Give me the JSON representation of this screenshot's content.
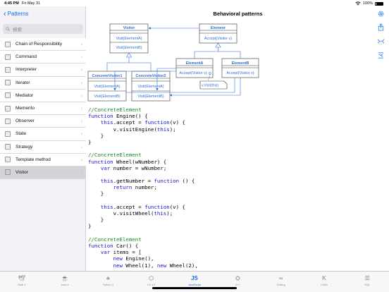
{
  "status": {
    "time": "4:45 PM",
    "date": "Fri May 31",
    "battery": "100%"
  },
  "nav": {
    "back_label": "Patterns",
    "title": "Behavioral patterns"
  },
  "search": {
    "placeholder": "検索"
  },
  "sidebar": {
    "items": [
      {
        "label": "Chain of Responsibility",
        "selected": false
      },
      {
        "label": "Command",
        "selected": false
      },
      {
        "label": "Interpreter",
        "selected": false
      },
      {
        "label": "Iterator",
        "selected": false
      },
      {
        "label": "Mediator",
        "selected": false
      },
      {
        "label": "Memento",
        "selected": false
      },
      {
        "label": "Observer",
        "selected": false
      },
      {
        "label": "State",
        "selected": false
      },
      {
        "label": "Strategy",
        "selected": false
      },
      {
        "label": "Template method",
        "selected": false
      },
      {
        "label": "Visitor",
        "selected": true
      }
    ]
  },
  "diagram": {
    "visitor": {
      "name": "Visitor",
      "m1": "Visit(ElementA)",
      "m2": "Visit(ElementB)"
    },
    "element": {
      "name": "Elemenr",
      "m1": "Accept(Visitor v)"
    },
    "cv1": {
      "name": "ConcreteVisitor1",
      "m1": "Visit(ElementA)",
      "m2": "Visit(ElementB)"
    },
    "cv2": {
      "name": "ConcreteVisitor2",
      "m1": "Visit(ElementA)",
      "m2": "Visit(ElementB)"
    },
    "ea": {
      "name": "ElementA",
      "m1": "Accept(Visitor v)"
    },
    "eb": {
      "name": "ElementB",
      "m1": "Accept(Visitor v)"
    },
    "note": "v.Visit(this)"
  },
  "code": {
    "lines": [
      [
        [
          "cm",
          "//ConcreteElement"
        ]
      ],
      [
        [
          "kw",
          "function"
        ],
        [
          "nm",
          " Engine() {"
        ]
      ],
      [
        [
          "nm",
          "    "
        ],
        [
          "kw",
          "this"
        ],
        [
          "nm",
          ".accept = "
        ],
        [
          "kw",
          "function"
        ],
        [
          "nm",
          "(v) {"
        ]
      ],
      [
        [
          "nm",
          "        v.visitEngine("
        ],
        [
          "kw",
          "this"
        ],
        [
          "nm",
          ");"
        ]
      ],
      [
        [
          "nm",
          "    }"
        ]
      ],
      [
        [
          "nm",
          "}"
        ]
      ],
      [
        [
          "nm",
          ""
        ]
      ],
      [
        [
          "cm",
          "//ConcreteElement"
        ]
      ],
      [
        [
          "kw",
          "function"
        ],
        [
          "nm",
          " Wheel(wNumber) {"
        ]
      ],
      [
        [
          "nm",
          "    "
        ],
        [
          "kw",
          "var"
        ],
        [
          "nm",
          " number = wNumber;"
        ]
      ],
      [
        [
          "nm",
          ""
        ]
      ],
      [
        [
          "nm",
          "    "
        ],
        [
          "kw",
          "this"
        ],
        [
          "nm",
          ".getNumber = "
        ],
        [
          "kw",
          "function"
        ],
        [
          "nm",
          " () {"
        ]
      ],
      [
        [
          "nm",
          "        "
        ],
        [
          "kw",
          "return"
        ],
        [
          "nm",
          " number;"
        ]
      ],
      [
        [
          "nm",
          "    }"
        ]
      ],
      [
        [
          "nm",
          ""
        ]
      ],
      [
        [
          "nm",
          "    "
        ],
        [
          "kw",
          "this"
        ],
        [
          "nm",
          ".accept = "
        ],
        [
          "kw",
          "function"
        ],
        [
          "nm",
          "(v) {"
        ]
      ],
      [
        [
          "nm",
          "        v.visitWheel("
        ],
        [
          "kw",
          "this"
        ],
        [
          "nm",
          ");"
        ]
      ],
      [
        [
          "nm",
          "    }"
        ]
      ],
      [
        [
          "nm",
          "}"
        ]
      ],
      [
        [
          "nm",
          ""
        ]
      ],
      [
        [
          "cm",
          "//ConcreteElement"
        ]
      ],
      [
        [
          "kw",
          "function"
        ],
        [
          "nm",
          " Car() {"
        ]
      ],
      [
        [
          "nm",
          "    "
        ],
        [
          "kw",
          "var"
        ],
        [
          "nm",
          " items = ["
        ]
      ],
      [
        [
          "nm",
          "        "
        ],
        [
          "kw",
          "new"
        ],
        [
          "nm",
          " Engine(),"
        ]
      ],
      [
        [
          "nm",
          "        "
        ],
        [
          "kw",
          "new"
        ],
        [
          "nm",
          " Wheel(1), "
        ],
        [
          "kw",
          "new"
        ],
        [
          "nm",
          " Wheel(2),"
        ]
      ]
    ]
  },
  "tabs": [
    {
      "label": "Swift 4",
      "icon": "swift-icon",
      "glyph": "🕊",
      "active": false
    },
    {
      "label": "Java 8",
      "icon": "java-icon",
      "glyph": "☕",
      "active": false
    },
    {
      "label": "Python 3",
      "icon": "python-icon",
      "glyph": "♣",
      "active": false
    },
    {
      "label": "C# 3.0",
      "icon": "csharp-icon",
      "glyph": "⬡",
      "active": false
    },
    {
      "label": "JavaScript",
      "icon": "javascript-icon",
      "glyph": "JS",
      "active": true
    },
    {
      "label": "C++",
      "icon": "cpp-icon",
      "glyph": "⛭",
      "active": false
    },
    {
      "label": "Golang",
      "icon": "golang-icon",
      "glyph": "∞",
      "active": false
    },
    {
      "label": "Kotlin",
      "icon": "kotlin-icon",
      "glyph": "K",
      "active": false
    },
    {
      "label": "SQL",
      "icon": "sql-icon",
      "glyph": "☰",
      "active": false
    }
  ],
  "colors": {
    "accent": "#0a6ff0",
    "uml_line": "#2e6fd8",
    "comment": "#1a8a1a",
    "keyword": "#1515d0"
  }
}
